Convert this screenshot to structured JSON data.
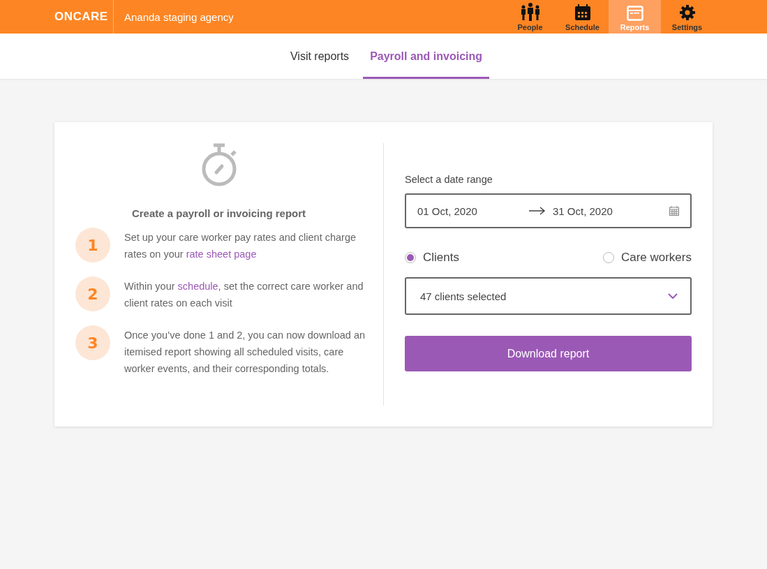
{
  "header": {
    "logo": "ONCARE",
    "agency": "Ananda staging agency",
    "nav": [
      {
        "kind": "people",
        "label": "People",
        "selected": false
      },
      {
        "kind": "schedule",
        "label": "Schedule",
        "selected": false
      },
      {
        "kind": "reports",
        "label": "Reports",
        "selected": true
      },
      {
        "kind": "settings",
        "label": "Settings",
        "selected": false
      }
    ]
  },
  "tabs": [
    {
      "label": "Visit reports",
      "selected": false
    },
    {
      "label": "Payroll and invoicing",
      "selected": true
    }
  ],
  "intro": {
    "title": "Create a payroll or invoicing report",
    "steps": [
      {
        "number": "1",
        "parts": [
          {
            "kind": "text",
            "text": "Set up your care worker pay rates and client charge rates on your "
          },
          {
            "kind": "link",
            "text": "rate sheet page"
          }
        ]
      },
      {
        "number": "2",
        "parts": [
          {
            "kind": "text",
            "text": "Within your "
          },
          {
            "kind": "link",
            "text": "schedule"
          },
          {
            "kind": "text",
            "text": ", set the correct care worker and client rates on each visit"
          }
        ]
      },
      {
        "number": "3",
        "parts": [
          {
            "kind": "text",
            "text": "Once you’ve done 1 and 2, you can now download an itemised report showing all scheduled visits, care worker events, and their corresponding totals."
          }
        ]
      }
    ]
  },
  "form": {
    "date_label": "Select a date range",
    "date_from": "01 Oct, 2020",
    "date_to": "31 Oct, 2020",
    "options": [
      {
        "label": "Clients",
        "selected": true
      },
      {
        "label": "Care workers",
        "selected": false
      }
    ],
    "dropdown": "47 clients selected",
    "button": "Download report"
  }
}
